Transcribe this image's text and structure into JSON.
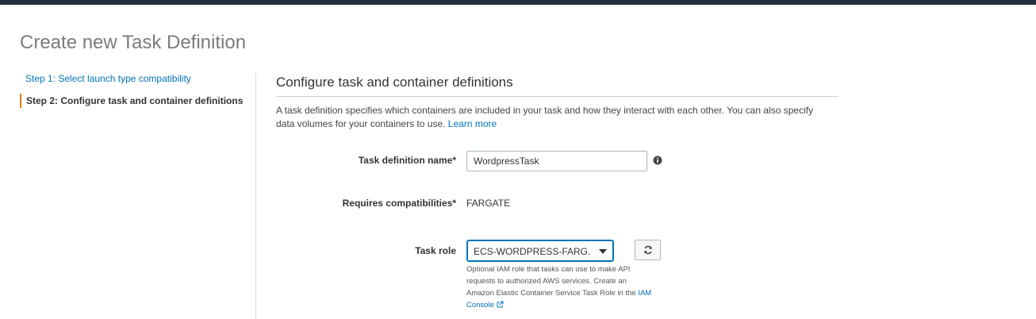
{
  "header": {
    "title": "Create new Task Definition"
  },
  "steps": [
    {
      "label": "Step 1: Select launch type compatibility"
    },
    {
      "label": "Step 2: Configure task and container definitions"
    }
  ],
  "section": {
    "title": "Configure task and container definitions",
    "description": "A task definition specifies which containers are included in your task and how they interact with each other. You can also specify data volumes for your containers to use.",
    "learn_more": "Learn more"
  },
  "form": {
    "task_name": {
      "label": "Task definition name*",
      "value": "WordpressTask"
    },
    "compatibilities": {
      "label": "Requires compatibilities*",
      "value": "FARGATE"
    },
    "task_role": {
      "label": "Task role",
      "selected": "ECS-WORDPRESS-FARG...",
      "help": "Optional IAM role that tasks can use to make API requests to authorized AWS services. Create an Amazon Elastic Container Service Task Role in the",
      "help_link": "IAM Console"
    }
  },
  "icons": {
    "info": "info-icon",
    "refresh": "refresh-icon",
    "external_link": "external-link-icon",
    "dropdown": "chevron-down-icon"
  },
  "colors": {
    "topbar": "#232f3e",
    "link": "#0073bb",
    "active_step_marker": "#e07b1e"
  }
}
